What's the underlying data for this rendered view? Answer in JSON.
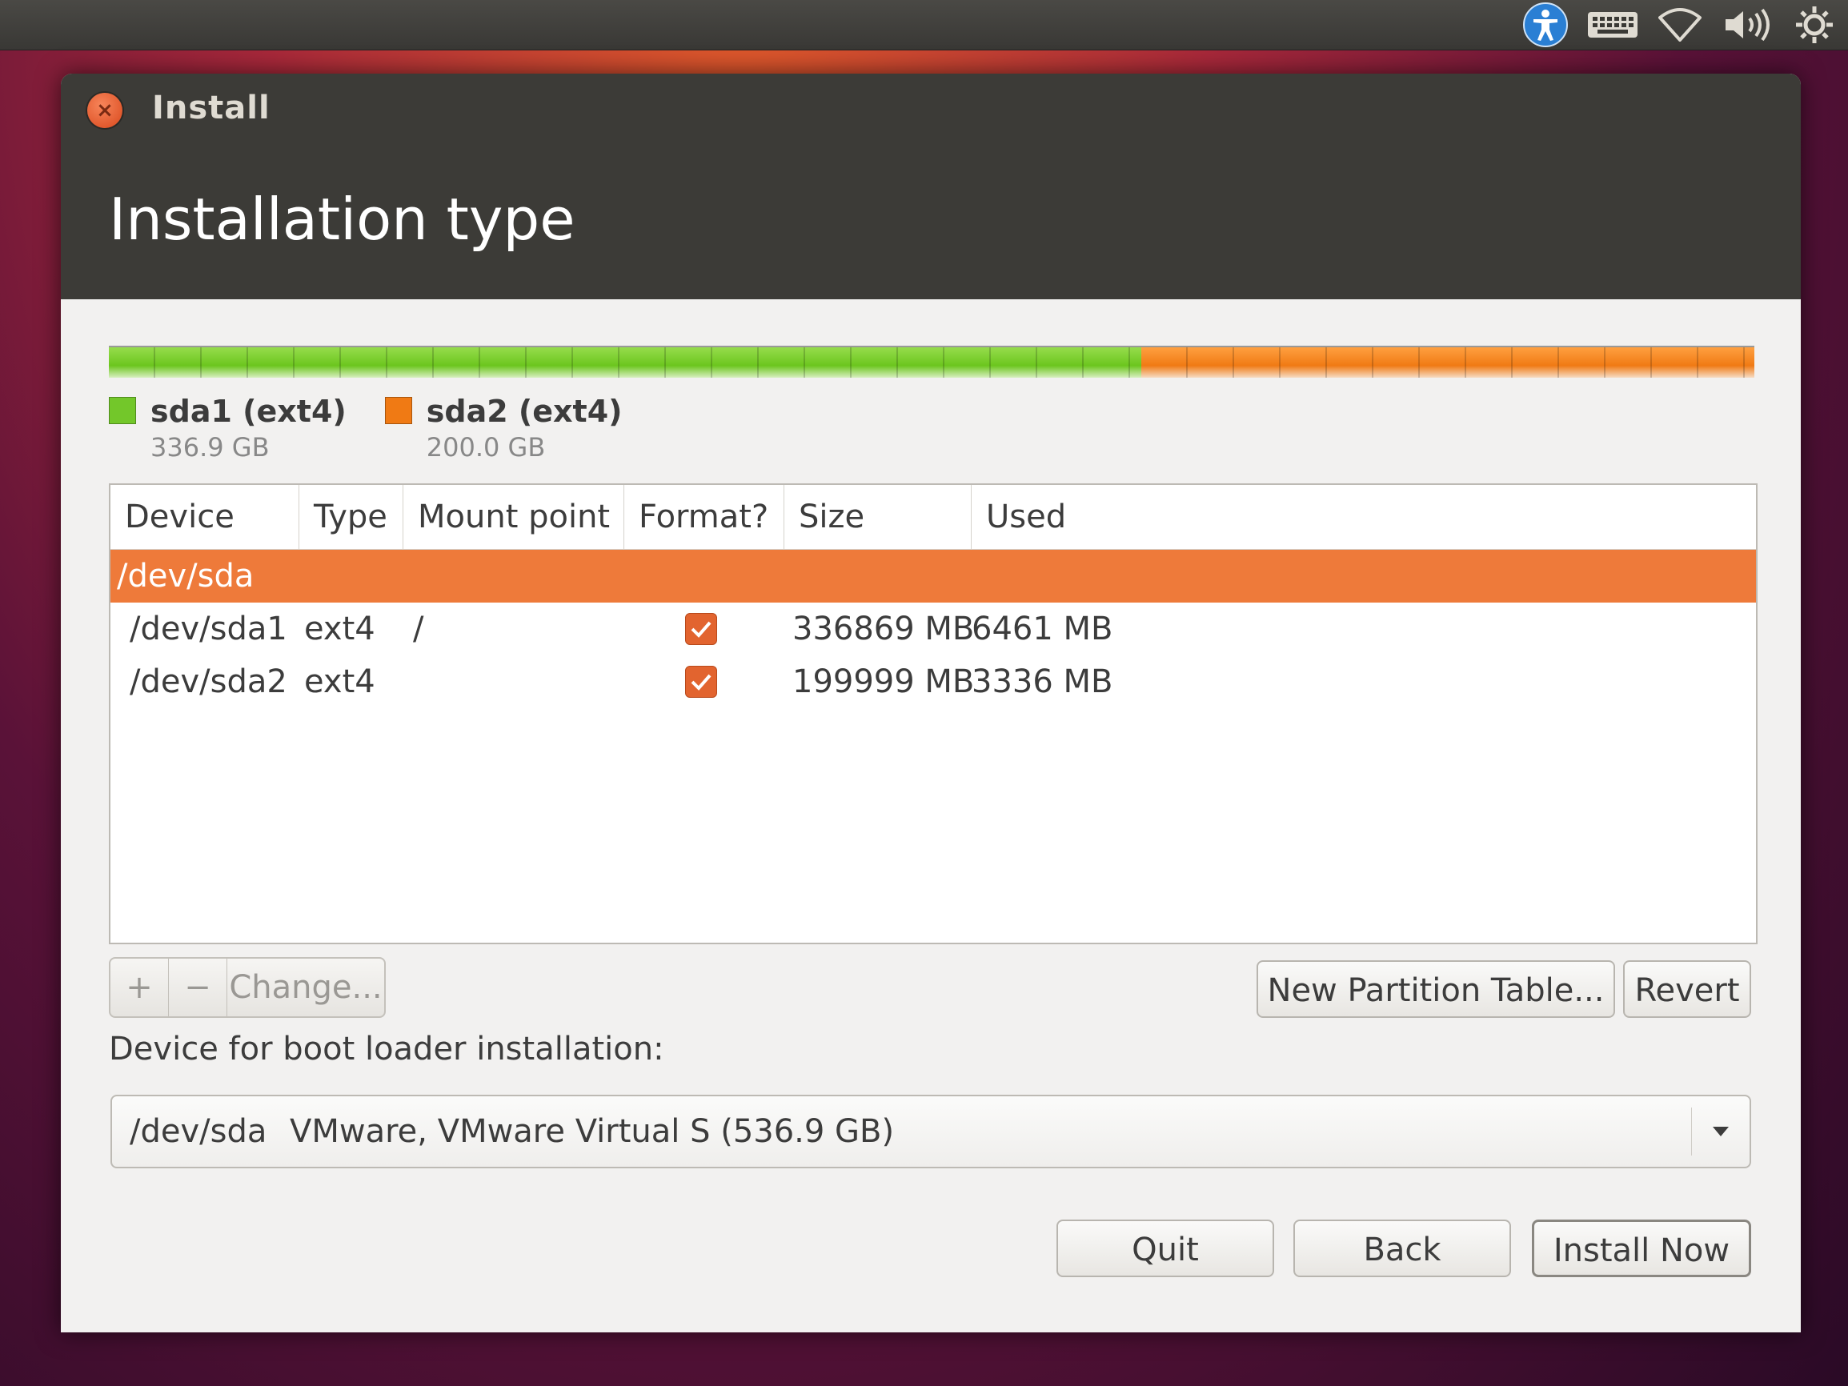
{
  "window": {
    "title": "Install",
    "page_title": "Installation type"
  },
  "tray": {
    "icons": [
      "accessibility-icon",
      "keyboard-icon",
      "network-icon",
      "volume-icon",
      "settings-icon"
    ]
  },
  "partitions": [
    {
      "name": "sda1 (ext4)",
      "size": "336.9 GB",
      "color": "#73c72a"
    },
    {
      "name": "sda2 (ext4)",
      "size": "200.0 GB",
      "color": "#f07a14"
    }
  ],
  "table": {
    "headers": [
      "Device",
      "Type",
      "Mount point",
      "Format?",
      "Size",
      "Used"
    ],
    "device_row": "/dev/sda",
    "rows": [
      {
        "device": "/dev/sda1",
        "type": "ext4",
        "mount": "/",
        "format": true,
        "size": "336869 MB",
        "used": "6461 MB"
      },
      {
        "device": "/dev/sda2",
        "type": "ext4",
        "mount": "",
        "format": true,
        "size": "199999 MB",
        "used": "3336 MB"
      }
    ]
  },
  "toolbar": {
    "add": "+",
    "remove": "−",
    "change": "Change...",
    "new_partition_table": "New Partition Table...",
    "revert": "Revert"
  },
  "bootloader": {
    "label": "Device for boot loader installation:",
    "device": "/dev/sda",
    "description": "VMware, VMware Virtual S (536.9 GB)"
  },
  "buttons": {
    "quit": "Quit",
    "back": "Back",
    "install_now": "Install Now"
  },
  "colors": {
    "accent": "#ee7a3a",
    "sda1": "#73c72a",
    "sda2": "#f07a14",
    "titlebar": "#3c3b37"
  }
}
